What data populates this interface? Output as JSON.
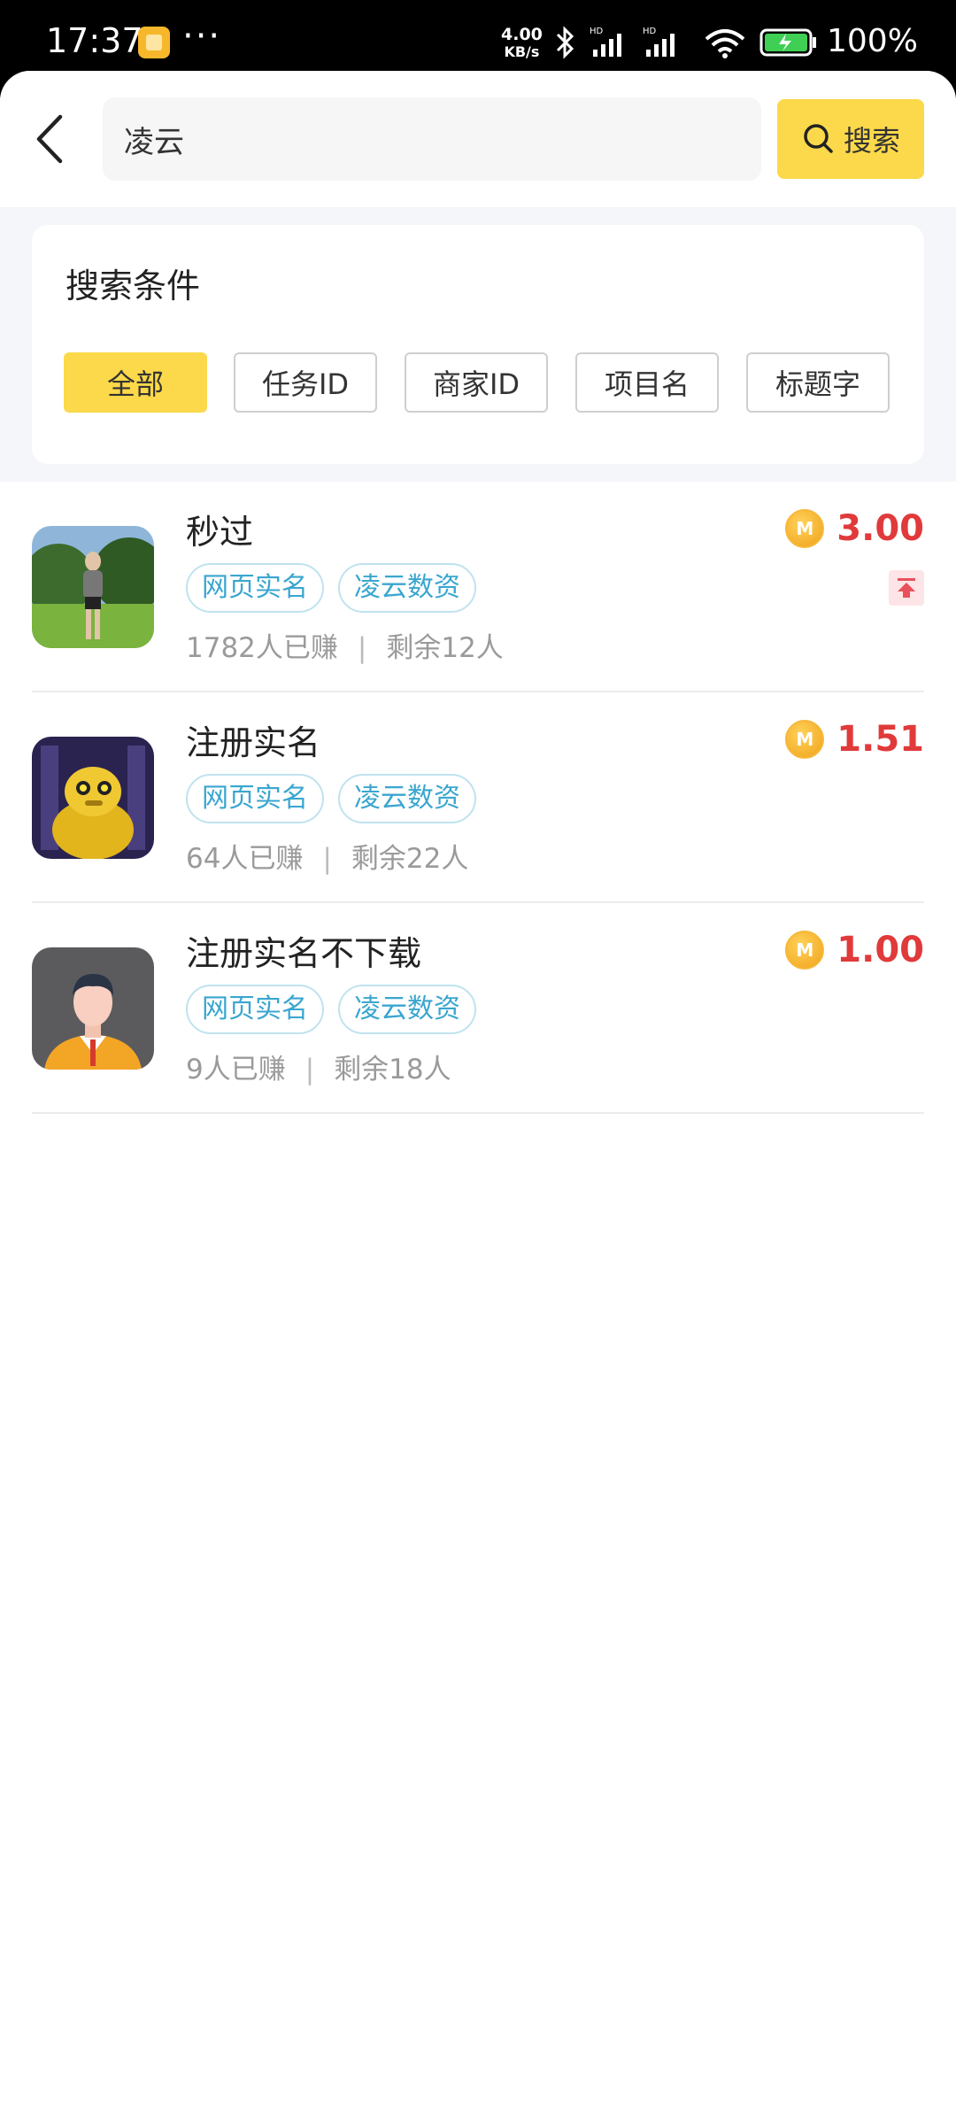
{
  "status_bar": {
    "time": "17:37",
    "more": "···",
    "net_speed_value": "4.00",
    "net_speed_unit": "KB/s",
    "battery": "100%"
  },
  "header": {
    "search_value": "凌云",
    "search_button": "搜索"
  },
  "filter": {
    "title": "搜索条件",
    "chips": [
      "全部",
      "任务ID",
      "商家ID",
      "项目名",
      "标题字"
    ],
    "active_index": 0,
    "active_color": "#fbd94a"
  },
  "tasks": [
    {
      "title": "秒过",
      "tags": [
        "网页实名",
        "凌云数资"
      ],
      "earned": "1782人已赚",
      "remaining": "剩余12人",
      "price": "3.00",
      "pinned": true,
      "thumb": "woman-in-park-photo"
    },
    {
      "title": "注册实名",
      "tags": [
        "网页实名",
        "凌云数资"
      ],
      "earned": "64人已赚",
      "remaining": "剩余22人",
      "price": "1.51",
      "pinned": false,
      "thumb": "golden-robot-avatar"
    },
    {
      "title": "注册实名不下载",
      "tags": [
        "网页实名",
        "凌云数资"
      ],
      "earned": "9人已赚",
      "remaining": "剩余18人",
      "price": "1.00",
      "pinned": false,
      "thumb": "businessman-avatar"
    }
  ],
  "colors": {
    "accent": "#fbd94a",
    "price": "#e03a3a",
    "tag": "#3aa6cf"
  }
}
